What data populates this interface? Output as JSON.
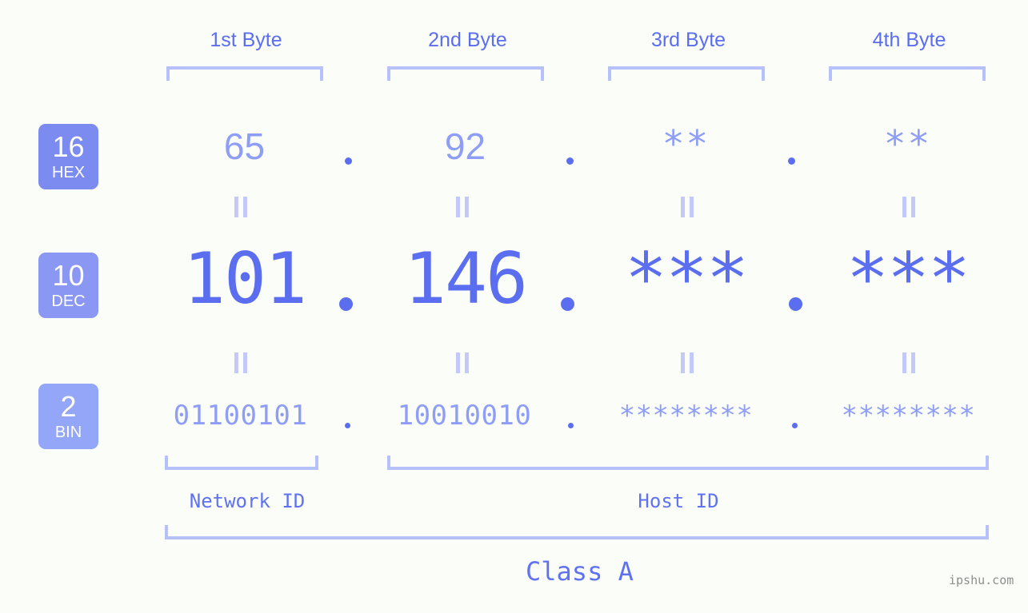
{
  "bytes": {
    "headers": [
      {
        "label": "1st Byte"
      },
      {
        "label": "2nd Byte"
      },
      {
        "label": "3rd Byte"
      },
      {
        "label": "4th Byte"
      }
    ]
  },
  "bases": [
    {
      "number": "16",
      "name": "HEX",
      "color": "#7b8bef"
    },
    {
      "number": "10",
      "name": "DEC",
      "color": "#8a98f4"
    },
    {
      "number": "2",
      "name": "BIN",
      "color": "#93a6f7"
    }
  ],
  "rows": {
    "hex": {
      "values": [
        "65",
        "92",
        "**",
        "**"
      ],
      "separator": "."
    },
    "dec": {
      "values": [
        "101",
        "146",
        "***",
        "***"
      ],
      "separator": "."
    },
    "bin": {
      "values": [
        "01100101",
        "10010010",
        "********",
        "********"
      ],
      "separator": "."
    }
  },
  "equals_mark": "||",
  "segments": {
    "network_id": "Network ID",
    "host_id": "Host ID",
    "class": "Class A"
  },
  "watermark": "ipshu.com",
  "colors": {
    "background": "#fbfdf8",
    "accent_strong": "#5b6ef0",
    "accent_light": "#8e9df6",
    "bracket": "#b6c0fb",
    "eqmark": "#c3caf9",
    "watermark": "#8f8f8f"
  }
}
